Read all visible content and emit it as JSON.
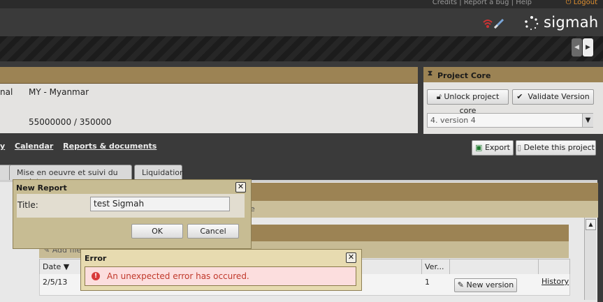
{
  "header": {
    "links": "Credits | Report a bug | Help",
    "logout": "Logout",
    "logo": "sigmah"
  },
  "project": {
    "field1_label": "nal",
    "field1_value": "MY - Myanmar",
    "field2_value": "55000000 / 350000"
  },
  "core": {
    "title": "Project Core",
    "unlock_label": "Unlock project core",
    "validate_label": "Validate Version",
    "version_selected": "4. version 4"
  },
  "links": {
    "items": [
      "y",
      "Calendar",
      "Reports & documents"
    ]
  },
  "actions": {
    "export_label": "Export",
    "delete_label": "Delete this project"
  },
  "tabs": [
    "",
    "Mise en oeuvre et suivi du projet",
    "Liquidation"
  ],
  "content": {
    "band_text": "e",
    "add_file_label": "Add file",
    "columns": {
      "date": "Date",
      "version": "Ver..."
    },
    "row": {
      "date": "2/5/13",
      "version": "1",
      "new_version_label": "New version",
      "history_label": "History"
    }
  },
  "report_dialog": {
    "title": "New Report",
    "title_label": "Title:",
    "title_value": "test Sigmah",
    "ok_label": "OK",
    "cancel_label": "Cancel"
  },
  "error_dialog": {
    "title": "Error",
    "message": "An unexpected error has occured."
  },
  "colors": {
    "accent": "#9c8354",
    "error_bg": "#fcdede",
    "error_text": "#c0392b",
    "logout": "#e09030"
  }
}
